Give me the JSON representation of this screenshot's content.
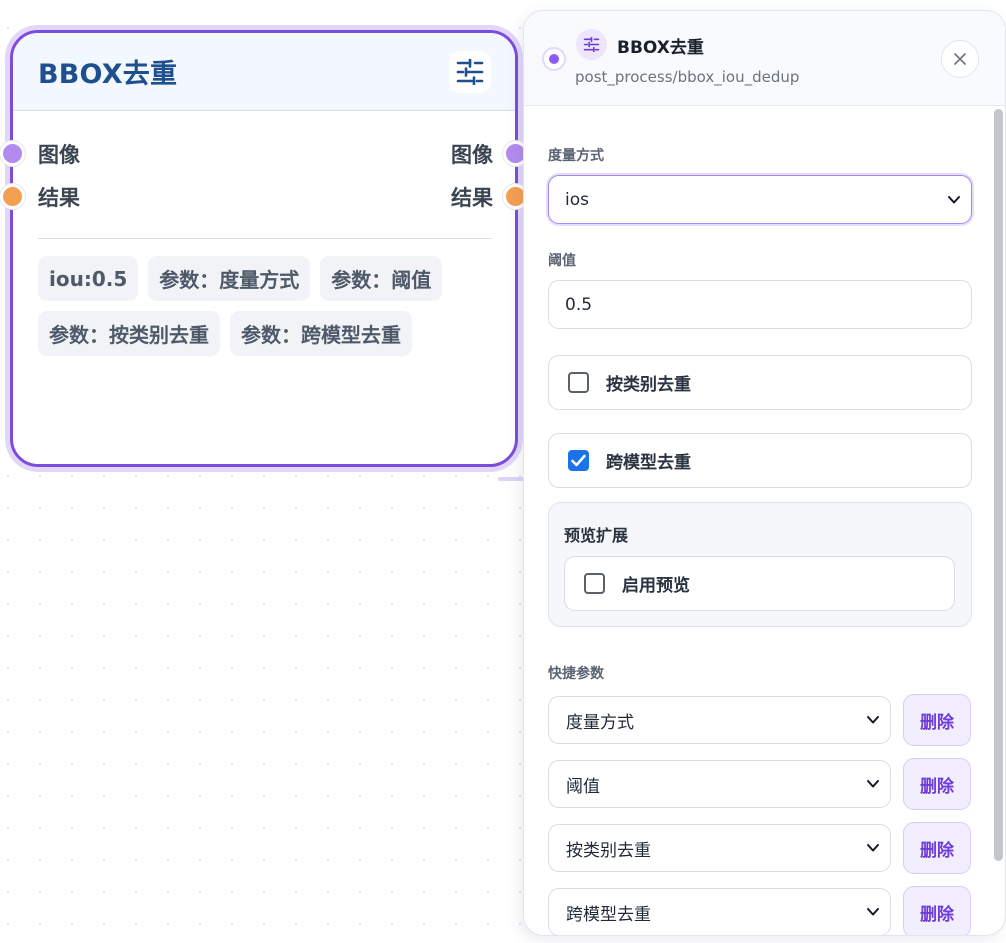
{
  "node": {
    "title": "BBOX去重",
    "inputs": [
      {
        "label": "图像",
        "color": "#b38bf0"
      },
      {
        "label": "结果",
        "color": "#f4a052"
      }
    ],
    "outputs": [
      {
        "label": "图像",
        "color": "#b38bf0"
      },
      {
        "label": "结果",
        "color": "#f4a052"
      }
    ],
    "chips": [
      "iou:0.5",
      "参数：度量方式",
      "参数：阈值",
      "参数：按类别去重",
      "参数：跨模型去重"
    ],
    "border_color": "#7c4ddd",
    "title_color": "#1e4f8e"
  },
  "panel": {
    "title": "BBOX去重",
    "path": "post_process/bbox_iou_dedup",
    "close_icon": "close-icon",
    "fields": {
      "metric": {
        "label": "度量方式",
        "value": "ios"
      },
      "threshold": {
        "label": "阈值",
        "value": "0.5"
      },
      "per_class": {
        "label": "按类别去重",
        "checked": false
      },
      "cross_model": {
        "label": "跨模型去重",
        "checked": true
      }
    },
    "preview_ext": {
      "title": "预览扩展",
      "enable": {
        "label": "启用预览",
        "checked": false
      }
    },
    "quick_params": {
      "label": "快捷参数",
      "rows": [
        {
          "value": "度量方式",
          "delete_label": "删除"
        },
        {
          "value": "阈值",
          "delete_label": "删除"
        },
        {
          "value": "按类别去重",
          "delete_label": "删除"
        },
        {
          "value": "跨模型去重",
          "delete_label": "删除"
        }
      ]
    },
    "accent_color": "#8b5cf6",
    "checkbox_color": "#1a73e8"
  }
}
